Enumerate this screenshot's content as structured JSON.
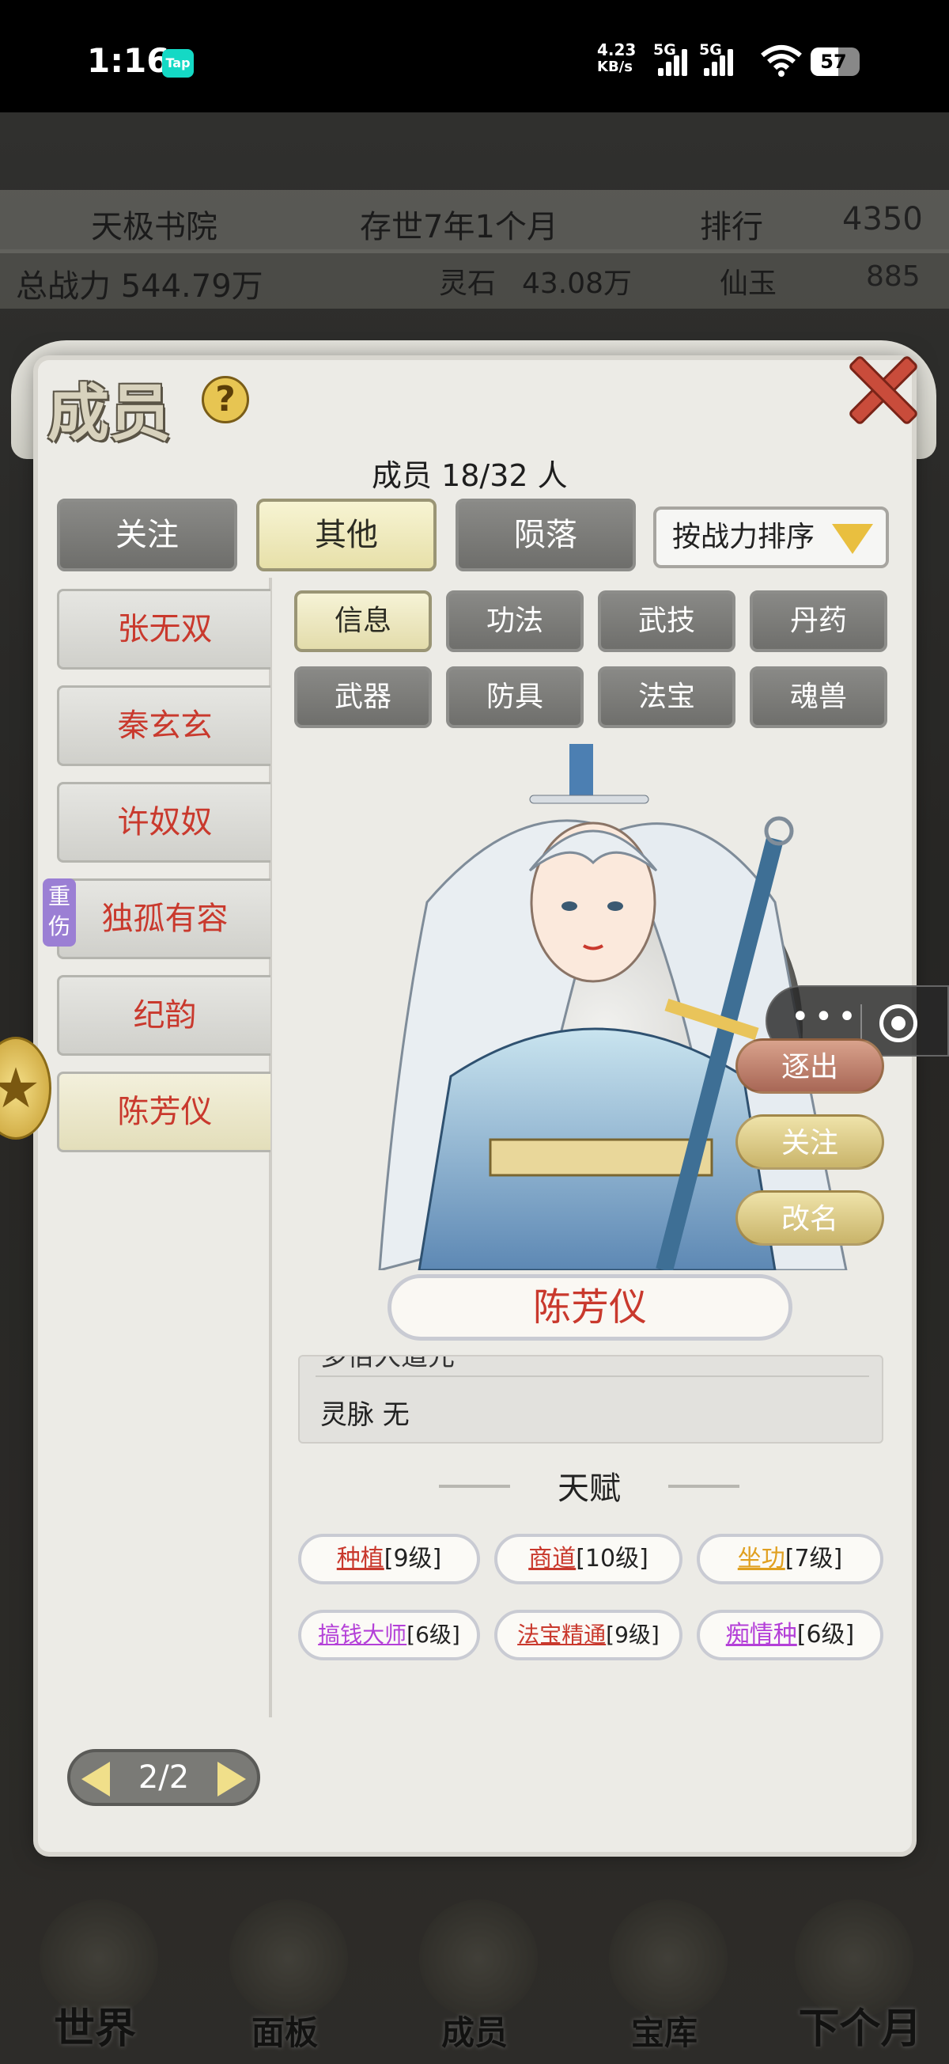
{
  "status_bar": {
    "time": "1:16",
    "app_badge": "Tap",
    "net_speed_value": "4.23",
    "net_speed_unit": "KB/s",
    "signal_1": "5G",
    "signal_2": "5G",
    "battery": "57"
  },
  "header": {
    "sect_name": "天极书院",
    "existence": "存世7年1个月",
    "rank_label": "排行",
    "rank_value": "4350",
    "total_power": "总战力 544.79万",
    "spirit_stone_label": "灵石",
    "spirit_stone_value": "43.08万",
    "xianyu_label": "仙玉",
    "xianyu_value": "885"
  },
  "panel": {
    "title": "成员",
    "help": "?",
    "member_count": "成员  18/32 人",
    "tabs": [
      {
        "label": "关注"
      },
      {
        "label": "其他"
      },
      {
        "label": "陨落"
      }
    ],
    "sort_label": "按战力排序",
    "members": [
      {
        "name": "张无双"
      },
      {
        "name": "秦玄玄"
      },
      {
        "name": "许奴奴"
      },
      {
        "name": "独孤有容"
      },
      {
        "name": "纪韵"
      },
      {
        "name": "陈芳仪"
      }
    ],
    "injured_badge": "重伤",
    "sub_tabs": [
      {
        "label": "信息"
      },
      {
        "label": "功法"
      },
      {
        "label": "武技"
      },
      {
        "label": "丹药"
      },
      {
        "label": "武器"
      },
      {
        "label": "防具"
      },
      {
        "label": "法宝"
      },
      {
        "label": "魂兽"
      }
    ],
    "actions": {
      "expel": "逐出",
      "follow": "关注",
      "rename": "改名"
    },
    "character_name": "陈芳仪",
    "info_cut_line": "多佰人道元",
    "info_line": "灵脉 无",
    "talent_title": "天赋",
    "talents": [
      {
        "name": "种植",
        "level": "[9级]",
        "color": "#c9392d"
      },
      {
        "name": "商道",
        "level": "[10级]",
        "color": "#c9392d"
      },
      {
        "name": "坐功",
        "level": "[7级]",
        "color": "#e0a020"
      },
      {
        "name": "搞钱大师",
        "level": "[6级]",
        "color": "#b440d8"
      },
      {
        "name": "法宝精通",
        "level": "[9级]",
        "color": "#c9392d"
      },
      {
        "name": "痴情种",
        "level": "[6级]",
        "color": "#b440d8"
      }
    ],
    "pager": "2/2"
  },
  "bottom_nav": [
    {
      "label": "世界"
    },
    {
      "label": "面板"
    },
    {
      "label": "成员"
    },
    {
      "label": "宝库"
    },
    {
      "label": "下个月"
    }
  ]
}
